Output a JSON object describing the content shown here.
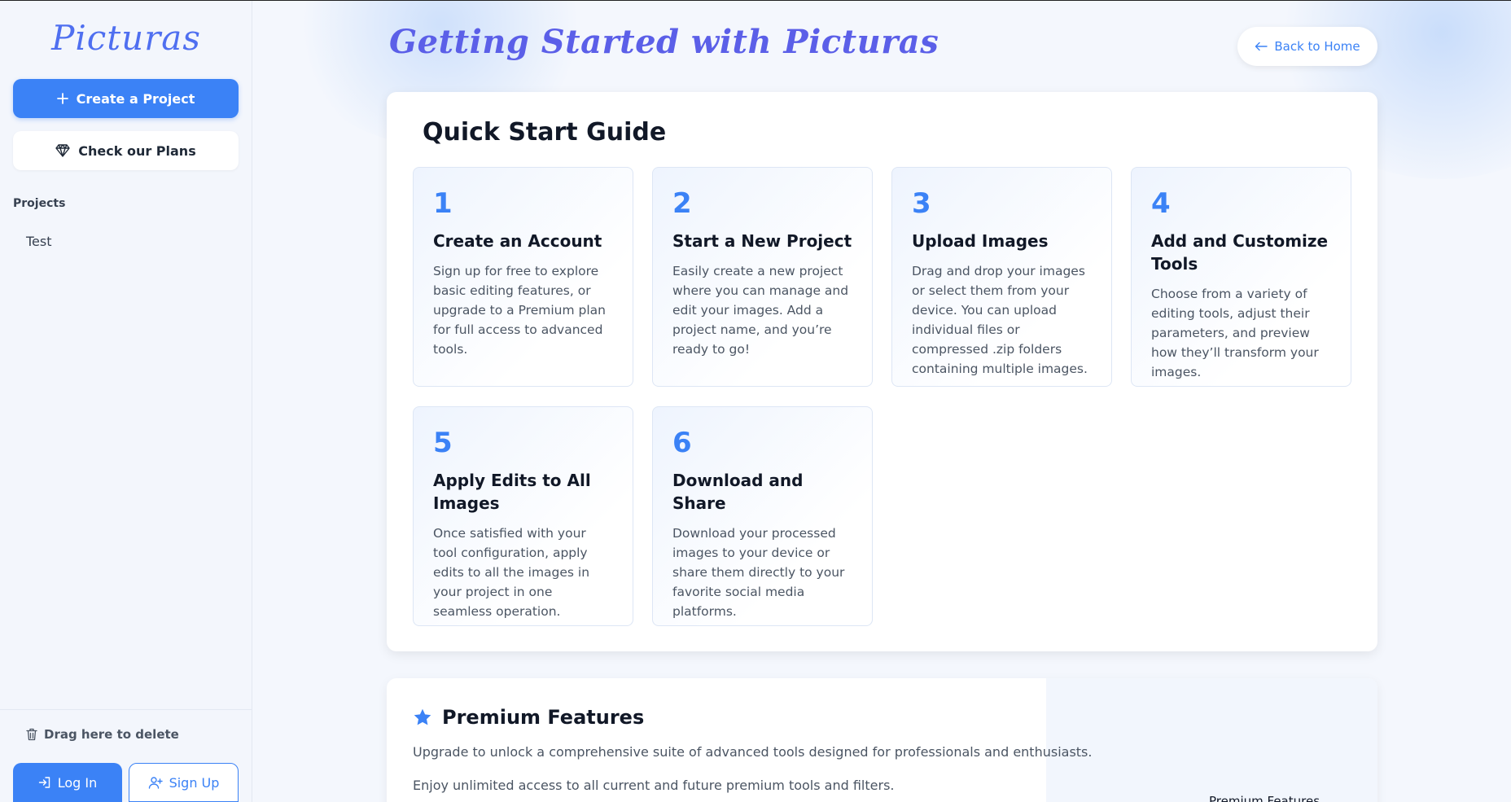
{
  "sidebar": {
    "logo": "Picturas",
    "create_project": "Create a Project",
    "check_plans": "Check our Plans",
    "projects_label": "Projects",
    "projects": [
      "Test"
    ],
    "delete_zone": "Drag here to delete",
    "login": "Log In",
    "signup": "Sign Up"
  },
  "header": {
    "title": "Getting Started with Picturas",
    "back": "Back to Home"
  },
  "guide": {
    "title": "Quick Start Guide",
    "steps": [
      {
        "num": "1",
        "title": "Create an Account",
        "desc": "Sign up for free to explore basic editing features, or upgrade to a Premium plan for full access to advanced tools."
      },
      {
        "num": "2",
        "title": "Start a New Project",
        "desc": "Easily create a new project where you can manage and edit your images. Add a project name, and you’re ready to go!"
      },
      {
        "num": "3",
        "title": "Upload Images",
        "desc": "Drag and drop your images or select them from your device. You can upload individual files or compressed .zip folders containing multiple images."
      },
      {
        "num": "4",
        "title": "Add and Customize Tools",
        "desc": "Choose from a variety of editing tools, adjust their parameters, and preview how they’ll transform your images."
      },
      {
        "num": "5",
        "title": "Apply Edits to All Images",
        "desc": "Once satisfied with your tool configuration, apply edits to all the images in your project in one seamless operation."
      },
      {
        "num": "6",
        "title": "Download and Share",
        "desc": "Download your processed images to your device or share them directly to your favorite social media platforms."
      }
    ]
  },
  "premium": {
    "title": "Premium Features",
    "p1": "Upgrade to unlock a comprehensive suite of advanced tools designed for professionals and enthusiasts.",
    "p2": "Enjoy unlimited access to all current and future premium tools and filters.",
    "caption": "Premium Features"
  },
  "colors": {
    "accent": "#3b82f6",
    "title_gradient": "#5b5fe8"
  },
  "icons": [
    "plus-icon",
    "diamond-icon",
    "trash-icon",
    "login-icon",
    "user-plus-icon",
    "arrow-left-icon",
    "star-icon"
  ]
}
